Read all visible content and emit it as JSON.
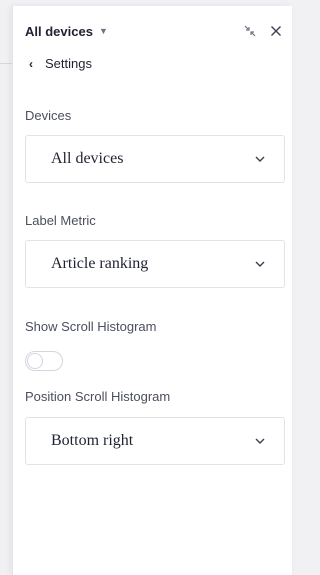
{
  "header": {
    "device_selector": "All devices",
    "icons": [
      "collapse-icon",
      "close-icon"
    ]
  },
  "nav": {
    "back_label": "Settings"
  },
  "fields": {
    "devices": {
      "label": "Devices",
      "value": "All devices"
    },
    "label_metric": {
      "label": "Label Metric",
      "value": "Article ranking"
    },
    "show_scroll_histogram": {
      "label": "Show Scroll Histogram",
      "enabled": false
    },
    "position_scroll_histogram": {
      "label": "Position Scroll Histogram",
      "value": "Bottom right"
    }
  },
  "colors": {
    "text": "#1f2230",
    "muted": "#4b4f5e",
    "border": "#e2e3ea",
    "panel_bg": "#ffffff",
    "page_bg": "#f1f1f4"
  }
}
